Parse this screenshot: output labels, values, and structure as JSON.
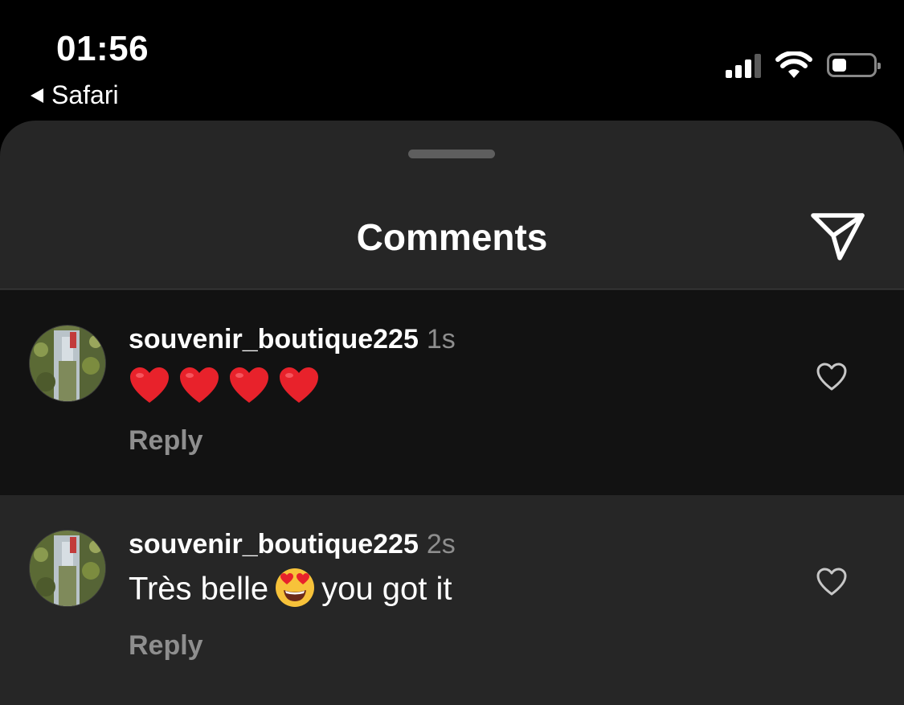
{
  "status_bar": {
    "time": "01:56",
    "back_app": "Safari",
    "battery_level": 0.35,
    "signal_bars": 3
  },
  "sheet": {
    "title": "Comments"
  },
  "comments": [
    {
      "username": "souvenir_boutique225",
      "time": "1s",
      "emoji": [
        "red-heart",
        "red-heart",
        "red-heart",
        "red-heart"
      ],
      "reply_label": "Reply"
    },
    {
      "username": "souvenir_boutique225",
      "time": "2s",
      "text_before": "Très belle",
      "emoji": "heart-eyes",
      "text_after": "you got it",
      "reply_label": "Reply"
    }
  ],
  "colors": {
    "sheet_bg": "#262626",
    "highlight_bg": "#121212",
    "secondary_text": "#8e8e8e",
    "heart_red": "#e8222b"
  }
}
